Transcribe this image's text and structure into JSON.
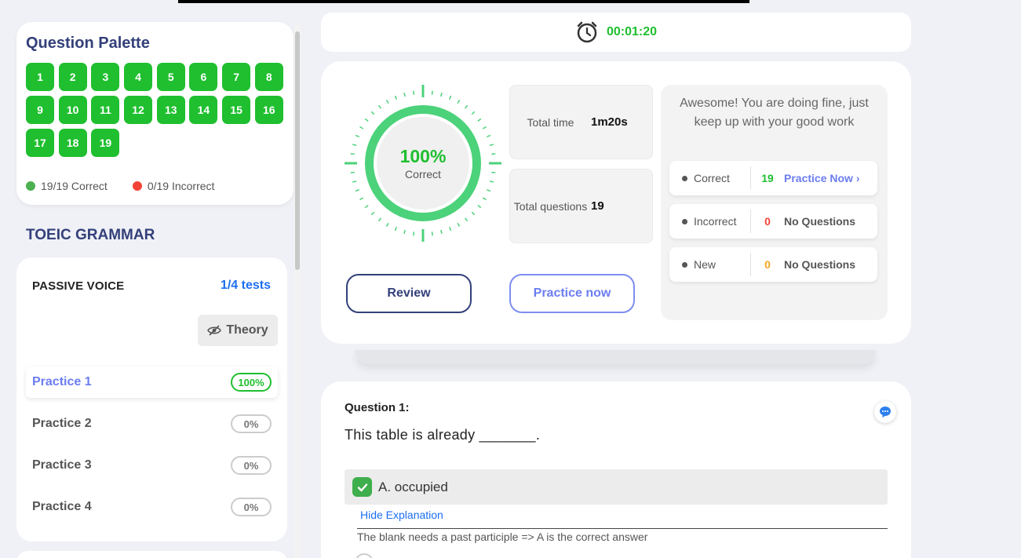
{
  "palette": {
    "title": "Question Palette",
    "questions": [
      "1",
      "2",
      "3",
      "4",
      "5",
      "6",
      "7",
      "8",
      "9",
      "10",
      "11",
      "12",
      "13",
      "14",
      "15",
      "16",
      "17",
      "18",
      "19"
    ],
    "correct_label": "19/19 Correct",
    "incorrect_label": "0/19 Incorrect",
    "colors": {
      "correct": "#4caf50",
      "incorrect": "#f44336",
      "question": "#1fbf2f"
    }
  },
  "sidebar": {
    "section_title": "TOEIC GRAMMAR",
    "topic": {
      "name": "PASSIVE VOICE",
      "count": "1/4 tests",
      "theory_label": "Theory",
      "practices": [
        {
          "label": "Practice 1",
          "score": "100%"
        },
        {
          "label": "Practice 2",
          "score": "0%"
        },
        {
          "label": "Practice 3",
          "score": "0%"
        },
        {
          "label": "Practice 4",
          "score": "0%"
        }
      ]
    }
  },
  "timer": {
    "time": "00:01:20",
    "icon": "alarm-clock-icon"
  },
  "results": {
    "percent_text": "100%",
    "percent_value": 100,
    "percent_sub": "Correct",
    "total_time_label": "Total time",
    "total_time_value": "1m20s",
    "total_questions_label": "Total questions",
    "total_questions_value": "19",
    "review_label": "Review",
    "practice_label": "Practice now",
    "message": "Awesome! You are doing fine, just keep up with your good work",
    "rows": [
      {
        "name": "Correct",
        "count": "19",
        "count_color": "#1fbf2f",
        "action": "Practice Now ›",
        "link": true
      },
      {
        "name": "Incorrect",
        "count": "0",
        "count_color": "#f44336",
        "action": "No Questions",
        "link": false
      },
      {
        "name": "New",
        "count": "0",
        "count_color": "#f5a623",
        "action": "No Questions",
        "link": false
      }
    ]
  },
  "question": {
    "number": "Question 1:",
    "text": "This table is already _______.",
    "answer": "A. occupied",
    "hide_explanation": "Hide Explanation",
    "explanation": "The blank needs a past participle => A is the correct answer"
  }
}
